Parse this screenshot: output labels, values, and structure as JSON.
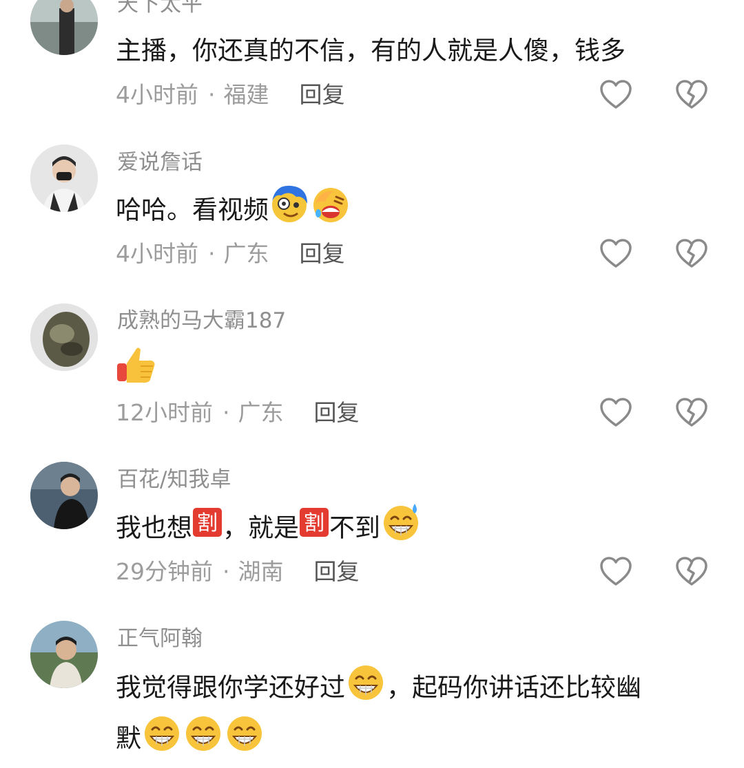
{
  "comments": [
    {
      "username": "天下太平",
      "text": "主播，你还真的不信，有的人就是人傻，钱多",
      "time": "4小时前",
      "location": "福建",
      "reply": "回复",
      "avatar_color": "#6f7d74"
    },
    {
      "username": "爱说詹话",
      "text": "哈哈。看视频",
      "emojis": [
        "dizzy-face-emoji",
        "facepalm-laugh-emoji"
      ],
      "time": "4小时前",
      "location": "广东",
      "reply": "回复",
      "avatar_color": "#d9d9d9"
    },
    {
      "username": "成熟的马大霸187",
      "emojis": [
        "thumbs-up-emoji"
      ],
      "time": "12小时前",
      "location": "广东",
      "reply": "回复",
      "avatar_color": "#6b6a58"
    },
    {
      "username": "百花/知我卓",
      "text_part1": "我也想",
      "text_part2": "，就是",
      "text_part3": "不到",
      "badge_char": "割",
      "emojis": [
        "cut-badge-emoji",
        "grin-sweat-emoji"
      ],
      "time": "29分钟前",
      "location": "湖南",
      "reply": "回复",
      "avatar_color": "#44586a"
    },
    {
      "username": "正气阿翰",
      "text_part1": "我觉得跟你学还好过",
      "text_part2": "，起码你讲话还比较幽",
      "text_part3": "默",
      "emojis": [
        "grin-emoji"
      ],
      "time": "",
      "location": "",
      "reply": "",
      "avatar_color": "#7fa0b4"
    }
  ],
  "colors": {
    "username": "#8f8f8f",
    "text": "#1a1a1a",
    "meta": "#9c9c9c",
    "reply": "#555555",
    "icon": "#8a8a8a"
  },
  "icons": [
    "heart-outline-icon",
    "broken-heart-icon"
  ]
}
